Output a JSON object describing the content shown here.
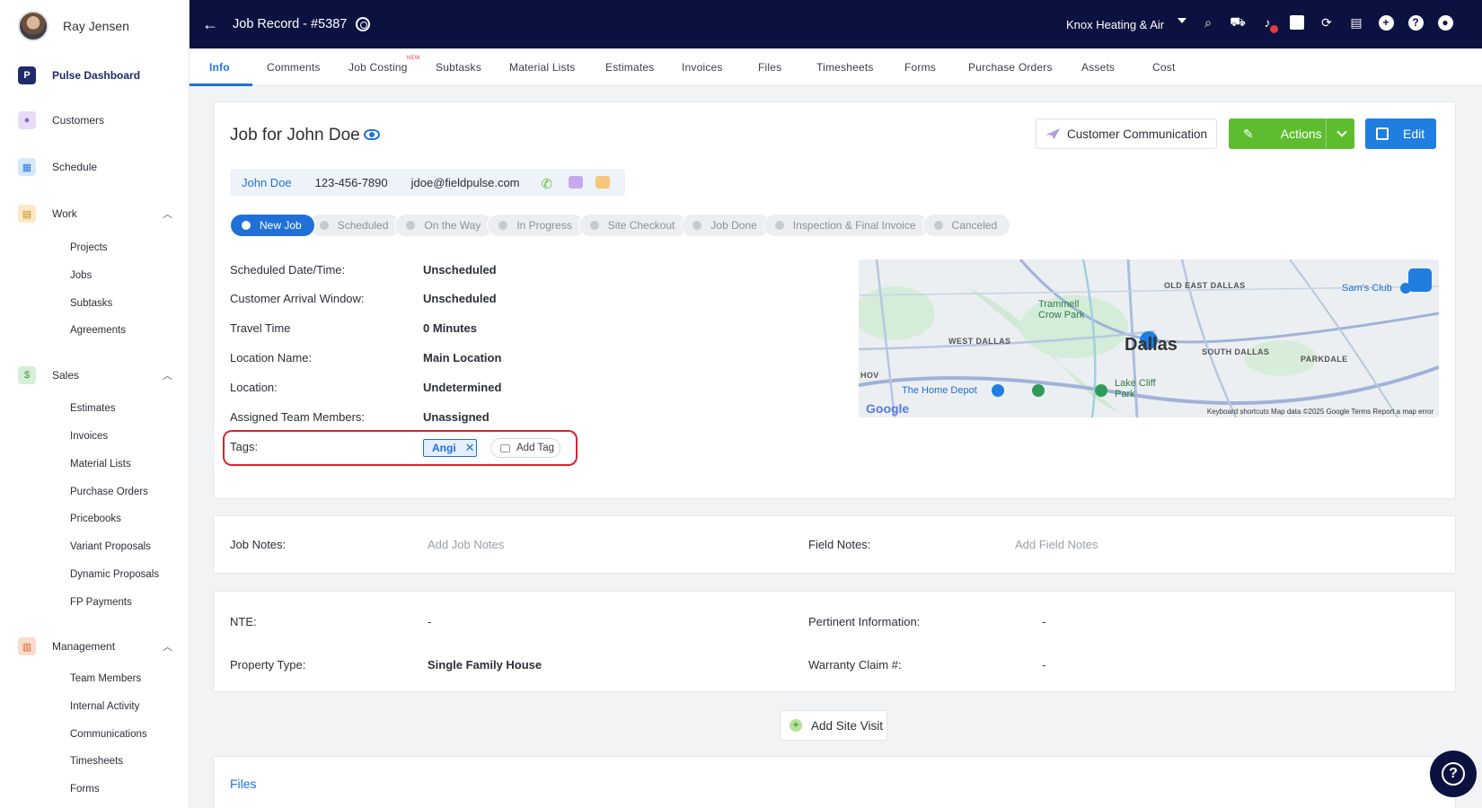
{
  "user": {
    "name": "Ray Jensen"
  },
  "sidebar": {
    "items": [
      {
        "label": "Pulse Dashboard",
        "icon": "pulse-logo-icon"
      },
      {
        "label": "Customers",
        "icon": "customers-icon"
      },
      {
        "label": "Schedule",
        "icon": "calendar-icon"
      },
      {
        "label": "Work",
        "icon": "clipboard-icon"
      },
      {
        "label": "Sales",
        "icon": "document-dollar-icon"
      },
      {
        "label": "Management",
        "icon": "management-icon"
      }
    ],
    "work_sub": [
      "Projects",
      "Jobs",
      "Subtasks",
      "Agreements"
    ],
    "sales_sub": [
      "Estimates",
      "Invoices",
      "Material Lists",
      "Purchase Orders",
      "Pricebooks",
      "Variant Proposals",
      "Dynamic Proposals",
      "FP Payments"
    ],
    "management_sub": [
      "Team Members",
      "Internal Activity",
      "Communications",
      "Timesheets",
      "Forms"
    ]
  },
  "header": {
    "title": "Job Record - #5387",
    "company": "Knox Heating & Air",
    "icons": [
      "search-icon",
      "truck-icon",
      "bell-icon",
      "note-icon",
      "sync-icon",
      "file-icon",
      "plus-icon",
      "help-icon",
      "account-icon"
    ]
  },
  "tabs": [
    {
      "label": "Info",
      "active": true
    },
    {
      "label": "Comments"
    },
    {
      "label": "Job Costing",
      "badge": "NEW"
    },
    {
      "label": "Subtasks"
    },
    {
      "label": "Material Lists"
    },
    {
      "label": "Estimates"
    },
    {
      "label": "Invoices"
    },
    {
      "label": "Files"
    },
    {
      "label": "Timesheets"
    },
    {
      "label": "Forms"
    },
    {
      "label": "Purchase Orders"
    },
    {
      "label": "Assets"
    },
    {
      "label": "Cost"
    }
  ],
  "job": {
    "title": "Job for John Doe",
    "contact": {
      "name": "John Doe",
      "phone": "123-456-7890",
      "email": "jdoe@fieldpulse.com"
    },
    "buttons": {
      "communication": "Customer Communication",
      "actions": "Actions",
      "edit": "Edit"
    },
    "stages": [
      "New Job",
      "Scheduled",
      "On the Way",
      "In Progress",
      "Site Checkout",
      "Job Done",
      "Inspection & Final Invoice",
      "Canceled"
    ],
    "details": [
      {
        "label": "Scheduled Date/Time:",
        "value": "Unscheduled"
      },
      {
        "label": "Customer Arrival Window:",
        "value": "Unscheduled"
      },
      {
        "label": "Travel Time",
        "value": "0 Minutes"
      },
      {
        "label": "Location Name:",
        "value": "Main Location"
      },
      {
        "label": "Location:",
        "value": "Undetermined"
      },
      {
        "label": "Assigned Team Members:",
        "value": "Unassigned"
      }
    ],
    "tags_label": "Tags:",
    "tag": "Angi",
    "add_tag": "Add Tag"
  },
  "map": {
    "labels": [
      "OLD EAST DALLAS",
      "WEST DALLAS",
      "SOUTH DALLAS",
      "PARKDALE",
      "HOV"
    ],
    "places": [
      "Trammell Crow Park",
      "Sam's Club",
      "The Home Depot",
      "Lake Cliff Park"
    ],
    "city": "Dallas",
    "google": "Google",
    "footer": "Keyboard shortcuts   Map data ©2025 Google   Terms   Report a map error"
  },
  "notes": {
    "job_label": "Job Notes:",
    "job_placeholder": "Add Job Notes",
    "field_label": "Field Notes:",
    "field_placeholder": "Add Field Notes"
  },
  "props": {
    "nte_label": "NTE:",
    "nte_value": "-",
    "pertinent_label": "Pertinent Information:",
    "pertinent_value": "-",
    "property_label": "Property Type:",
    "property_value": "Single Family House",
    "warranty_label": "Warranty Claim #:",
    "warranty_value": "-"
  },
  "add_site_visit": "Add Site Visit",
  "files_title": "Files"
}
